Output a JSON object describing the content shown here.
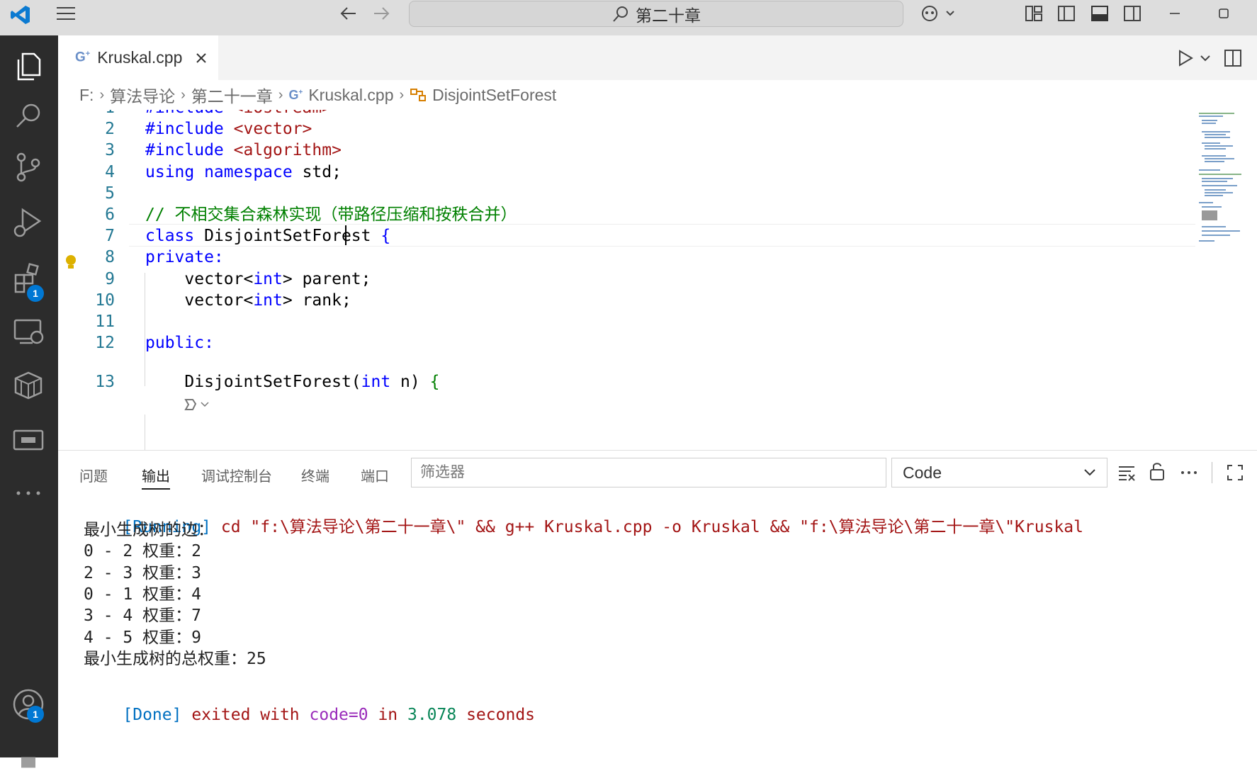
{
  "titlebar": {
    "search_text": "第二十章"
  },
  "activity_bar": {
    "extensions_badge": "1",
    "accounts_badge": "1"
  },
  "tabs": [
    {
      "label": "Kruskal.cpp",
      "active": true
    }
  ],
  "breadcrumb": {
    "drive": "F:",
    "folder1": "算法导论",
    "folder2": "第二十一章",
    "file": "Kruskal.cpp",
    "symbol": "DisjointSetForest"
  },
  "editor": {
    "lines": [
      {
        "num": "1",
        "tokens": [
          {
            "t": "#include ",
            "c": "kw"
          },
          {
            "t": "<iostream>",
            "c": "str"
          }
        ]
      },
      {
        "num": "2",
        "tokens": [
          {
            "t": "#include ",
            "c": "kw"
          },
          {
            "t": "<vector>",
            "c": "str"
          }
        ]
      },
      {
        "num": "3",
        "tokens": [
          {
            "t": "#include ",
            "c": "kw"
          },
          {
            "t": "<algorithm>",
            "c": "str"
          }
        ]
      },
      {
        "num": "4",
        "tokens": [
          {
            "t": "using namespace ",
            "c": "kw"
          },
          {
            "t": "std;",
            "c": "plain"
          }
        ]
      },
      {
        "num": "5",
        "tokens": []
      },
      {
        "num": "6",
        "tokens": [
          {
            "t": "// 不相交集合森林实现（带路径压缩和按秩合并）",
            "c": "cmt"
          }
        ]
      },
      {
        "num": "7",
        "tokens": [
          {
            "t": "class ",
            "c": "kw"
          },
          {
            "t": "DisjointSetForest ",
            "c": "plain"
          },
          {
            "t": "{",
            "c": "kw"
          }
        ]
      },
      {
        "num": "8",
        "tokens": [
          {
            "t": "private:",
            "c": "kw"
          }
        ]
      },
      {
        "num": "9",
        "tokens": [
          {
            "t": "    vector<",
            "c": "plain"
          },
          {
            "t": "int",
            "c": "kw"
          },
          {
            "t": "> parent;",
            "c": "plain"
          }
        ]
      },
      {
        "num": "10",
        "tokens": [
          {
            "t": "    vector<",
            "c": "plain"
          },
          {
            "t": "int",
            "c": "kw"
          },
          {
            "t": "> rank;",
            "c": "plain"
          }
        ]
      },
      {
        "num": "11",
        "tokens": []
      },
      {
        "num": "12",
        "tokens": [
          {
            "t": "public:",
            "c": "kw"
          }
        ]
      },
      {
        "num": "13",
        "tokens": [
          {
            "t": "    DisjointSetForest",
            "c": "plain"
          },
          {
            "t": "(",
            "c": "plain"
          },
          {
            "t": "int",
            "c": "kw"
          },
          {
            "t": " n) ",
            "c": "plain"
          },
          {
            "t": "{",
            "c": "cmt"
          }
        ]
      }
    ]
  },
  "panel": {
    "tabs": [
      "问题",
      "输出",
      "调试控制台",
      "终端",
      "端口"
    ],
    "active_tab": "输出",
    "filter_placeholder": "筛选器",
    "channel": "Code",
    "output": {
      "run_tag": "[Running]",
      "run_cmd": " cd \"f:\\算法导论\\第二十一章\\\" && g++ Kruskal.cpp -o Kruskal && \"f:\\算法导论\\第二十一章\\\"Kruskal",
      "lines": [
        "最小生成树的边：",
        "0 - 2 权重：2",
        "2 - 3 权重：3",
        "0 - 1 权重：4",
        "3 - 4 权重：7",
        "4 - 5 权重：9",
        "最小生成树的总权重：25"
      ],
      "done_tag": "[Done]",
      "done_p1": " exited with ",
      "done_code": "code=0",
      "done_p2": " in ",
      "done_time": "3.078",
      "done_p3": " seconds"
    }
  }
}
